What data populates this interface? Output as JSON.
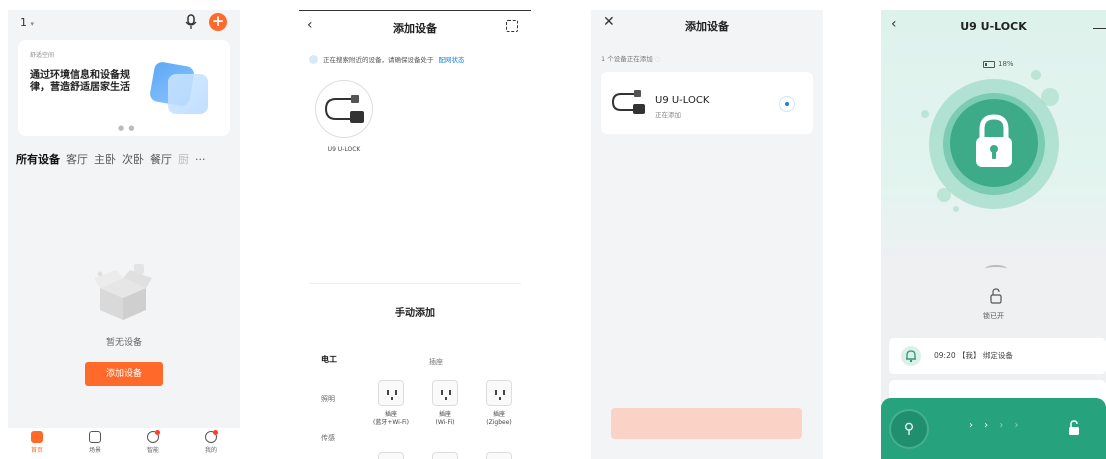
{
  "panel_home": {
    "top_label": "1",
    "banner": {
      "subtitle": "舒适空间",
      "title": "通过环境信息和设备规律，营造舒适居家生活",
      "dots": "● ●"
    },
    "room_tabs": [
      "所有设备",
      "客厅",
      "主卧",
      "次卧",
      "餐厅",
      "厨"
    ],
    "more_label": "···",
    "empty_text": "暂无设备",
    "add_device_label": "添加设备",
    "nav": [
      "首页",
      "场景",
      "智能",
      "我的"
    ],
    "accent": "#ff6a2a"
  },
  "panel_add": {
    "title": "添加设备",
    "search_text": "正在搜索附近的设备，请确保设备处于",
    "search_link": "配网状态",
    "found_device": "U9 U-LOCK",
    "manual_title": "手动添加",
    "categories": [
      "电工",
      "照明",
      "传感"
    ],
    "section_label": "插座",
    "plugs": [
      {
        "label": "插座\n(蓝牙+Wi-Fi)"
      },
      {
        "label": "插座\n(Wi-Fi)"
      },
      {
        "label": "插座\n(Zigbee)"
      }
    ]
  },
  "panel_adding": {
    "title": "添加设备",
    "count_text": "1 个设备正在添加",
    "device_name": "U9 U-LOCK",
    "device_status": "正在添加"
  },
  "panel_lock": {
    "title": "U9 U-LOCK",
    "battery": "18%",
    "lock_state": "锁已开",
    "log_entry": "09:20 【我】 绑定设备",
    "slide_arrows": "› › ",
    "slide_arrows_dim": "› ›",
    "accent": "#26a27c"
  }
}
